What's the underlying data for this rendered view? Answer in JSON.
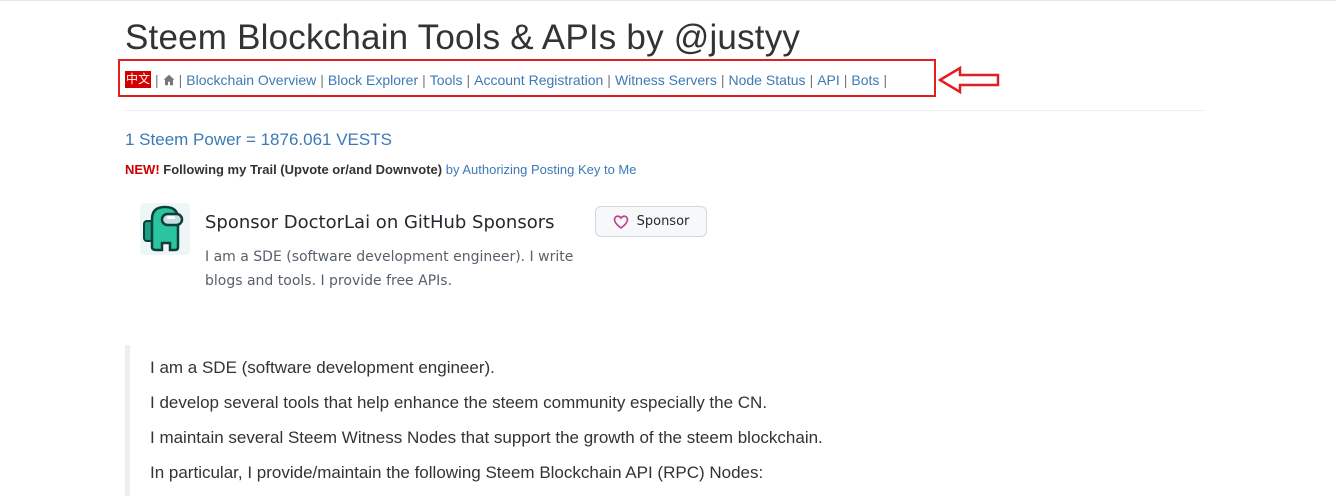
{
  "page": {
    "title": "Steem Blockchain Tools & APIs by @justyy"
  },
  "nav": {
    "lang_label": "中文",
    "separator": "|",
    "items": [
      {
        "label": "Blockchain Overview"
      },
      {
        "label": "Block Explorer"
      },
      {
        "label": "Tools"
      },
      {
        "label": "Account Registration"
      },
      {
        "label": "Witness Servers"
      },
      {
        "label": "Node Status"
      },
      {
        "label": "API"
      },
      {
        "label": "Bots"
      }
    ]
  },
  "steem_power": {
    "text": "1 Steem Power = 1876.061 VESTS"
  },
  "announcement": {
    "new_label": "NEW!",
    "text": "Following my Trail (Upvote or/and Downvote)",
    "link_text": "by Authorizing Posting Key to Me"
  },
  "sponsor": {
    "title": "Sponsor DoctorLai on GitHub Sponsors",
    "description": "I am a SDE (software development engineer). I write blogs and tools. I provide free APIs.",
    "button_label": "Sponsor"
  },
  "about": {
    "lines": [
      "I am a SDE (software development engineer).",
      "I develop several tools that help enhance the steem community especially the CN.",
      "I maintain several Steem Witness Nodes that support the growth of the steem blockchain.",
      "In particular, I provide/maintain the following Steem Blockchain API (RPC) Nodes:"
    ]
  },
  "colors": {
    "link": "#3c7ab6",
    "highlight": "#e02020",
    "new_badge": "#cc0000",
    "lang_badge_bg": "#d40000"
  },
  "icons": {
    "home": "home-icon",
    "heart": "heart-icon",
    "arrow": "left-arrow-icon"
  }
}
